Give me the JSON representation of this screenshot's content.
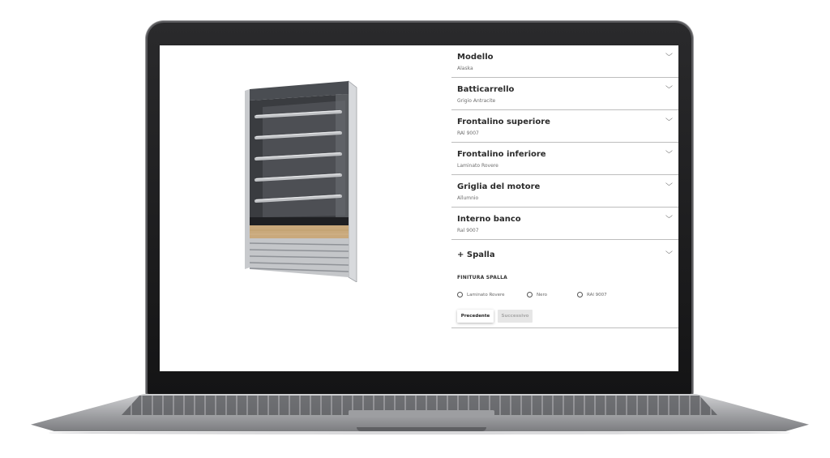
{
  "product": {
    "image_name": "refrigerated-display-case"
  },
  "accordion": [
    {
      "title": "Modello",
      "value": "Alaska"
    },
    {
      "title": "Batticarrello",
      "value": "Grigio Antracite"
    },
    {
      "title": "Frontalino superiore",
      "value": "RAl 9007"
    },
    {
      "title": "Frontalino inferiore",
      "value": "Laminato Rovere"
    },
    {
      "title": "Griglia del motore",
      "value": "Allumnio"
    },
    {
      "title": "Interno banco",
      "value": "Ral 9007"
    }
  ],
  "open_section": {
    "title": "+ Spalla",
    "field_label": "FINITURA SPALLA",
    "options": [
      "Laminato Rovere",
      "Nero",
      "RAl 9007"
    ],
    "selected": null,
    "prev_label": "Precedente",
    "next_label": "Successivo"
  },
  "icons": {
    "chevron": "chevron-down-icon",
    "radio": "radio-unchecked-icon"
  },
  "colors": {
    "laptop_bezel": "#1d1d1f",
    "laptop_body": "#a9aaad",
    "text_primary": "#2b2b2b",
    "divider": "#bdbdbd",
    "wood": "#c9a97c"
  }
}
